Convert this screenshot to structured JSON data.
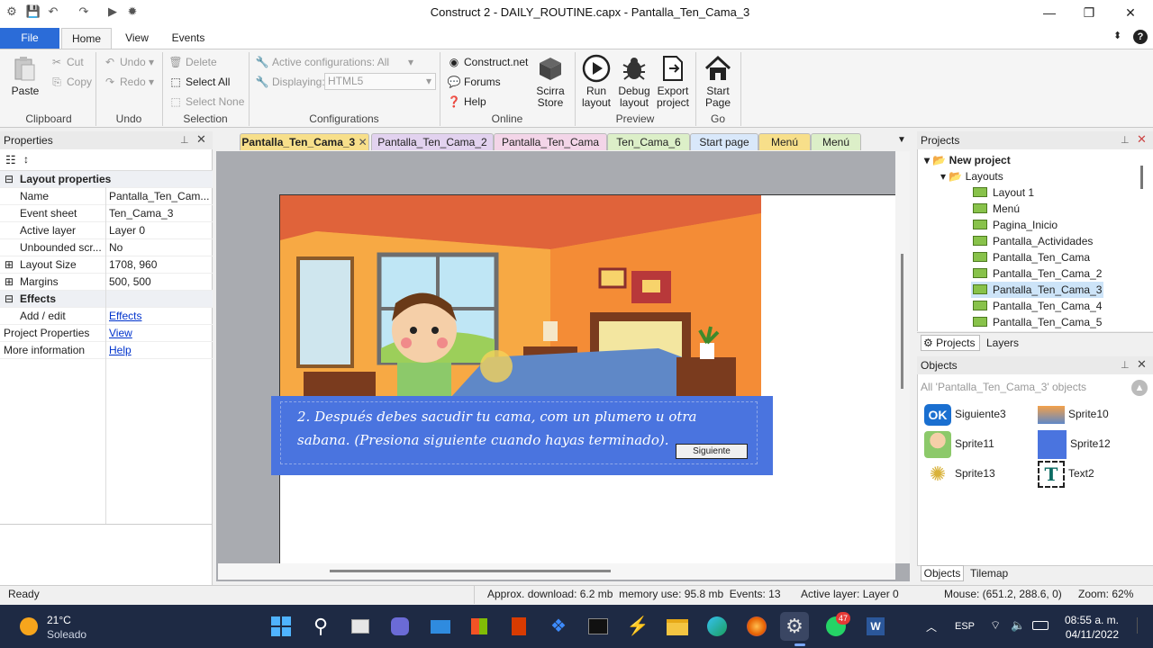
{
  "window": {
    "title": "Construct 2 - DAILY_ROUTINE.capx - Pantalla_Ten_Cama_3"
  },
  "ribbon_tabs": {
    "file": "File",
    "home": "Home",
    "view": "View",
    "events": "Events"
  },
  "clipboard": {
    "paste": "Paste",
    "cut": "Cut",
    "copy": "Copy",
    "label": "Clipboard"
  },
  "undo": {
    "undo": "Undo",
    "redo": "Redo",
    "label": "Undo"
  },
  "selection": {
    "delete": "Delete",
    "select_all": "Select All",
    "select_none": "Select None",
    "label": "Selection"
  },
  "configurations": {
    "active": "Active configurations: All",
    "displaying_label": "Displaying:",
    "displaying_value": "HTML5",
    "label": "Configurations"
  },
  "online": {
    "construct_net": "Construct.net",
    "forums": "Forums",
    "help": "Help",
    "scirra_store_1": "Scirra",
    "scirra_store_2": "Store",
    "label": "Online"
  },
  "preview": {
    "run_1": "Run",
    "run_2": "layout",
    "debug_1": "Debug",
    "debug_2": "layout",
    "export_1": "Export",
    "export_2": "project",
    "label": "Preview"
  },
  "go": {
    "start_1": "Start",
    "start_2": "Page",
    "label": "Go"
  },
  "properties": {
    "title": "Properties",
    "section_layout": "Layout properties",
    "name_k": "Name",
    "name_v": "Pantalla_Ten_Cam...",
    "event_k": "Event sheet",
    "event_v": "Ten_Cama_3",
    "layer_k": "Active layer",
    "layer_v": "Layer 0",
    "unb_k": "Unbounded scr...",
    "unb_v": "No",
    "size_k": "Layout Size",
    "size_v": "1708, 960",
    "margins_k": "Margins",
    "margins_v": "500, 500",
    "section_effects": "Effects",
    "addedit_k": "Add / edit",
    "addedit_v": "Effects",
    "proj_k": "Project Properties",
    "proj_v": "View",
    "more_k": "More information",
    "more_v": "Help"
  },
  "doc_tabs": [
    "Pantalla_Ten_Cama_3",
    "Pantalla_Ten_Cama_2",
    "Pantalla_Ten_Cama",
    "Ten_Cama_6",
    "Start page",
    "Menú",
    "Menú"
  ],
  "layout_canvas": {
    "instruction_1": "2. Después debes sacudir tu cama, com un plumero u otra",
    "instruction_2": "sabana. (Presiona siguiente cuando hayas terminado).",
    "next_button": "Siguiente"
  },
  "projects": {
    "title": "Projects",
    "root": "New project",
    "folder": "Layouts",
    "items": [
      "Layout 1",
      "Menú",
      "Pagina_Inicio",
      "Pantalla_Actividades",
      "Pantalla_Ten_Cama",
      "Pantalla_Ten_Cama_2",
      "Pantalla_Ten_Cama_3",
      "Pantalla_Ten_Cama_4",
      "Pantalla_Ten_Cama_5"
    ],
    "tab_projects": "Projects",
    "tab_layers": "Layers"
  },
  "objects": {
    "title": "Objects",
    "filter": "All 'Pantalla_Ten_Cama_3' objects",
    "items": [
      "Siguiente3",
      "Sprite10",
      "Sprite11",
      "Sprite12",
      "Sprite13",
      "Text2"
    ],
    "tab_objects": "Objects",
    "tab_tilemap": "Tilemap"
  },
  "status": {
    "ready": "Ready",
    "download": "Approx. download: 6.2 mb  memory use: 95.8 mb  Events: 13",
    "active_layer": "Active layer: Layer 0",
    "mouse": "Mouse: (651.2, 288.6, 0)",
    "zoom": "Zoom: 62%"
  },
  "taskbar": {
    "temp": "21°C",
    "weather": "Soleado",
    "lang": "ESP",
    "time": "08:55 a. m.",
    "date": "04/11/2022",
    "badge": "47"
  },
  "colors": {
    "accent": "#2b6cd8",
    "banner": "#4a74df",
    "tab_active": "#f7df8a"
  }
}
